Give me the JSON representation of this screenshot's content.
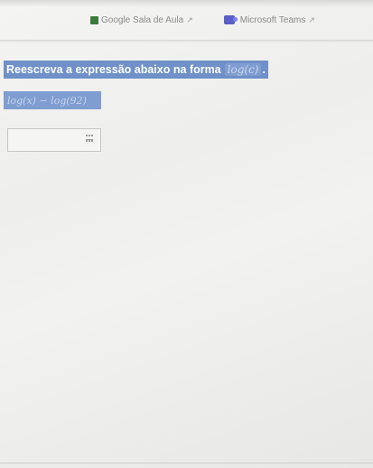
{
  "header": {
    "links": [
      {
        "label": "Google Sala de Aula",
        "icon": "google-classroom-icon"
      },
      {
        "label": "Microsoft Teams",
        "icon": "microsoft-teams-icon"
      }
    ]
  },
  "question": {
    "prompt": "Reescreva a expressão abaixo na forma",
    "form_target": "log(c)",
    "period": ".",
    "expression": "log(x) − log(92)"
  },
  "answer": {
    "value": ""
  },
  "colors": {
    "highlight": "#6f90c8"
  }
}
